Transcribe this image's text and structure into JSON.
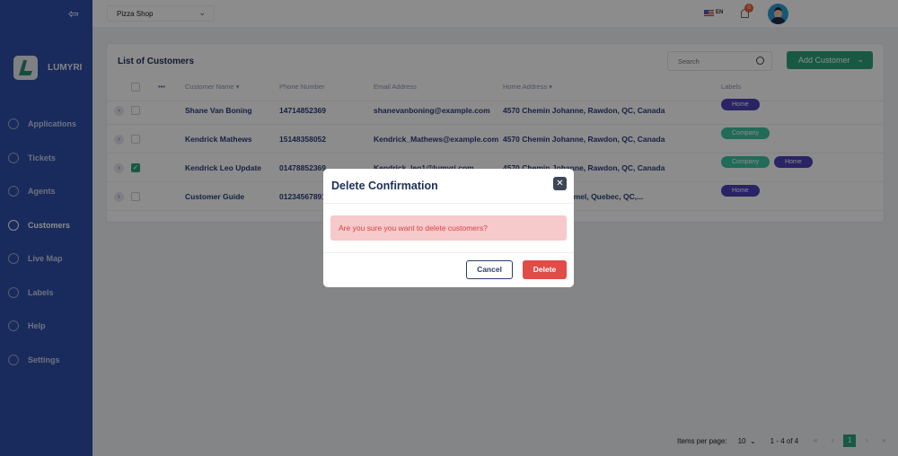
{
  "brand": "LUMYRI",
  "sidebar": {
    "items": [
      {
        "label": "Applications",
        "icon": "box-icon"
      },
      {
        "label": "Tickets",
        "icon": "ticket-icon"
      },
      {
        "label": "Agents",
        "icon": "agent-icon"
      },
      {
        "label": "Customers",
        "icon": "users-icon",
        "active": true
      },
      {
        "label": "Live Map",
        "icon": "map-pin-icon"
      },
      {
        "label": "Labels",
        "icon": "tag-icon"
      },
      {
        "label": "Help",
        "icon": "help-icon"
      },
      {
        "label": "Settings",
        "icon": "gear-icon"
      }
    ]
  },
  "header": {
    "shop": "Pizza Shop",
    "lang": "EN",
    "notifications": "0"
  },
  "card": {
    "title": "List of Customers",
    "search_placeholder": "Search",
    "add_label": "Add Customer"
  },
  "table": {
    "columns": {
      "name": "Customer Name",
      "phone": "Phone Number",
      "email": "Email Address",
      "address": "Home Address",
      "labels": "Labels"
    },
    "rows": [
      {
        "name": "Shane Van Boning",
        "phone": "14714852369",
        "email": "shanevanboning@example.com",
        "address": "4570 Chemin Johanne, Rawdon, QC, Canada",
        "labels": [
          "Home"
        ],
        "checked": false
      },
      {
        "name": "Kendrick Mathews",
        "phone": "15148358052",
        "email": "Kendrick_Mathews@example.com",
        "address": "4570 Chemin Johanne, Rawdon, QC, Canada",
        "labels": [
          "Company"
        ],
        "checked": false
      },
      {
        "name": "Kendrick Leo Update",
        "phone": "01478852369",
        "email": "Kendrick_leo1@lumyri.com",
        "address": "4570 Chemin Johanne, Rawdon, QC, Canada",
        "labels": [
          "Company",
          "Home"
        ],
        "checked": true
      },
      {
        "name": "Customer Guide",
        "phone": "01234567891",
        "email": "",
        "address": "-Hamel, Quebec, QC,...",
        "labels": [
          "Home"
        ],
        "checked": false
      }
    ]
  },
  "pagination": {
    "items_per_page_label": "Items per page:",
    "items_per_page": "10",
    "range": "1 - 4 of 4",
    "current_page": "1"
  },
  "modal": {
    "title": "Delete Confirmation",
    "message": "Are you sure you want to delete customers?",
    "cancel": "Cancel",
    "delete": "Delete"
  },
  "colors": {
    "sidebar": "#2f4fa8",
    "accent": "#2ea37c",
    "danger": "#e14c46",
    "home_tag": "#4e40b6",
    "company_tag": "#3cc4a0"
  }
}
